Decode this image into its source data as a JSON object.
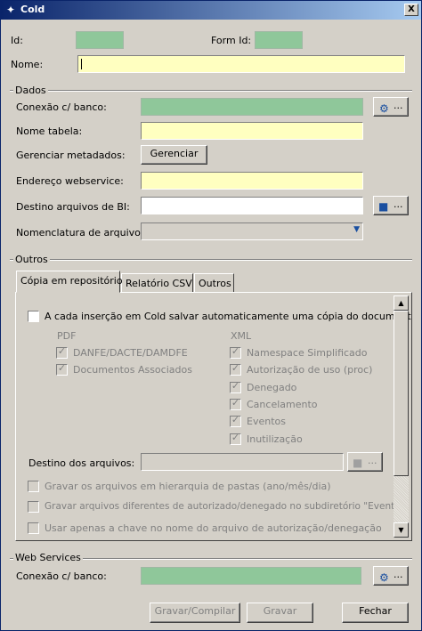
{
  "window": {
    "title": "Cold",
    "close_label": "X"
  },
  "header": {
    "id_label": "Id:",
    "form_id_label": "Form Id:",
    "nome_label": "Nome:",
    "nome_value": ""
  },
  "dados": {
    "group_label": "Dados",
    "conexao_label": "Conexão c/ banco:",
    "tabela_label": "Nome tabela:",
    "metadados_label": "Gerenciar metadados:",
    "gerenciar_button": "Gerenciar",
    "webservice_label": "Endereço webservice:",
    "destino_bi_label": "Destino arquivos de BI:",
    "nomenclatura_label": "Nomenclatura de arquivo:",
    "ellipsis": "..."
  },
  "outros": {
    "group_label": "Outros",
    "tabs": [
      {
        "label": "Cópia em repositório"
      },
      {
        "label": "Relatório CSV"
      },
      {
        "label": "Outros"
      }
    ],
    "auto_copy_label": "A cada inserção em Cold salvar automaticamente uma cópia do documento",
    "pdf_label": "PDF",
    "pdf_items": [
      {
        "label": "DANFE/DACTE/DAMDFE"
      },
      {
        "label": "Documentos Associados"
      }
    ],
    "xml_label": "XML",
    "xml_items": [
      {
        "label": "Namespace Simplificado"
      },
      {
        "label": "Autorização de uso (proc)"
      },
      {
        "label": "Denegado"
      },
      {
        "label": "Cancelamento"
      },
      {
        "label": "Eventos"
      },
      {
        "label": "Inutilização"
      }
    ],
    "destino_label": "Destino dos arquivos:",
    "options": [
      {
        "label": "Gravar os arquivos em hierarquia de pastas (ano/mês/dia)"
      },
      {
        "label": "Gravar arquivos diferentes de autorizado/denegado no subdiretório \"Eventos\""
      },
      {
        "label": "Usar apenas a chave no nome do arquivo de autorização/denegação"
      }
    ]
  },
  "webservices": {
    "group_label": "Web Services",
    "conexao_label": "Conexão c/ banco:"
  },
  "footer": {
    "gravar_compilar": "Gravar/Compilar",
    "gravar": "Gravar",
    "fechar": "Fechar"
  },
  "colors": {
    "title_start": "#0a246a",
    "title_end": "#a6caf0",
    "required": "#ffffc0",
    "readonly": "#8fc79a",
    "face": "#d4d0c8"
  }
}
